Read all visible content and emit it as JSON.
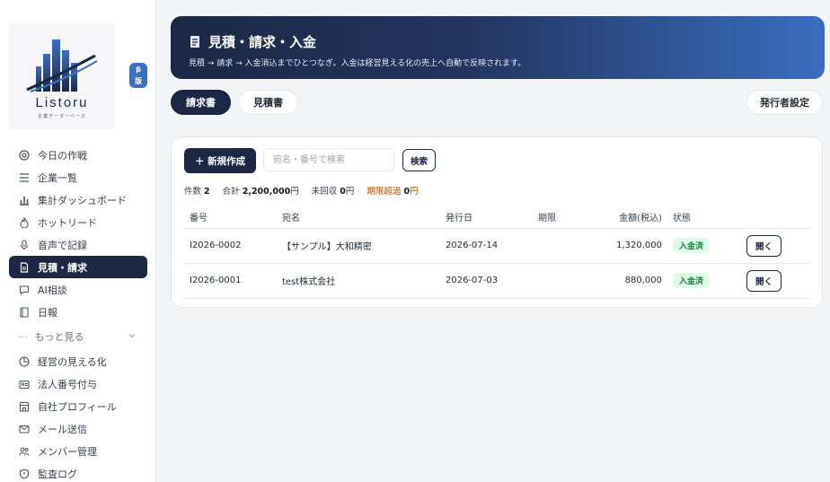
{
  "brand": {
    "name": "Listoru",
    "tagline": "企業データーベース",
    "beta_label_1": "β",
    "beta_label_2": "版"
  },
  "sidebar": {
    "items": [
      {
        "label": "今日の作戦",
        "icon": "target-icon"
      },
      {
        "label": "企業一覧",
        "icon": "list-icon"
      },
      {
        "label": "集計ダッシュボード",
        "icon": "bar-chart-icon"
      },
      {
        "label": "ホットリード",
        "icon": "flame-icon"
      },
      {
        "label": "音声で記録",
        "icon": "microphone-icon"
      },
      {
        "label": "見積・請求",
        "icon": "document-icon",
        "active": true
      },
      {
        "label": "AI相談",
        "icon": "chat-icon"
      },
      {
        "label": "日報",
        "icon": "notebook-icon"
      }
    ],
    "more_label": "もっと見る",
    "more_items": [
      {
        "label": "経営の見える化",
        "icon": "pie-chart-icon"
      },
      {
        "label": "法人番号付与",
        "icon": "id-card-icon"
      },
      {
        "label": "自社プロフィール",
        "icon": "store-icon"
      },
      {
        "label": "メール送信",
        "icon": "mail-icon"
      },
      {
        "label": "メンバー管理",
        "icon": "users-icon"
      },
      {
        "label": "監査ログ",
        "icon": "shield-icon"
      }
    ]
  },
  "banner": {
    "title": "見積・請求・入金",
    "subtitle": "見積 → 請求 → 入金消込までひとつなぎ。入金は経営見える化の売上へ自動で反映されます。"
  },
  "tabs": [
    {
      "label": "請求書",
      "active": true
    },
    {
      "label": "見積書",
      "active": false
    }
  ],
  "issuer_settings_label": "発行者設定",
  "toolbar": {
    "new_label": "＋ 新規作成",
    "search_placeholder": "宛名・番号で検索",
    "search_label": "検索"
  },
  "summary": {
    "count_label": "件数",
    "count": "2",
    "total_label": "合計",
    "total": "2,200,000",
    "total_unit": "円",
    "unpaid_label": "未回収",
    "unpaid": "0",
    "unpaid_unit": "円",
    "overdue_label": "期限超過",
    "overdue": "0",
    "overdue_unit": "円"
  },
  "table": {
    "headers": [
      "番号",
      "宛名",
      "発行日",
      "期限",
      "金額(税込)",
      "状態"
    ],
    "rows": [
      {
        "number": "I2026-0002",
        "recipient": "【サンプル】大和精密",
        "issue_date": "2026-07-14",
        "due": "",
        "amount": "1,320,000",
        "status": "入金済",
        "action": "開く"
      },
      {
        "number": "I2026-0001",
        "recipient": "test株式会社",
        "issue_date": "2026-07-03",
        "due": "",
        "amount": "880,000",
        "status": "入金済",
        "action": "開く"
      }
    ]
  },
  "colors": {
    "navy": "#1b2745",
    "accent": "#3a6dbf",
    "paid_bg": "#dcfce7",
    "paid_text": "#15803d",
    "warn": "#b45309"
  }
}
